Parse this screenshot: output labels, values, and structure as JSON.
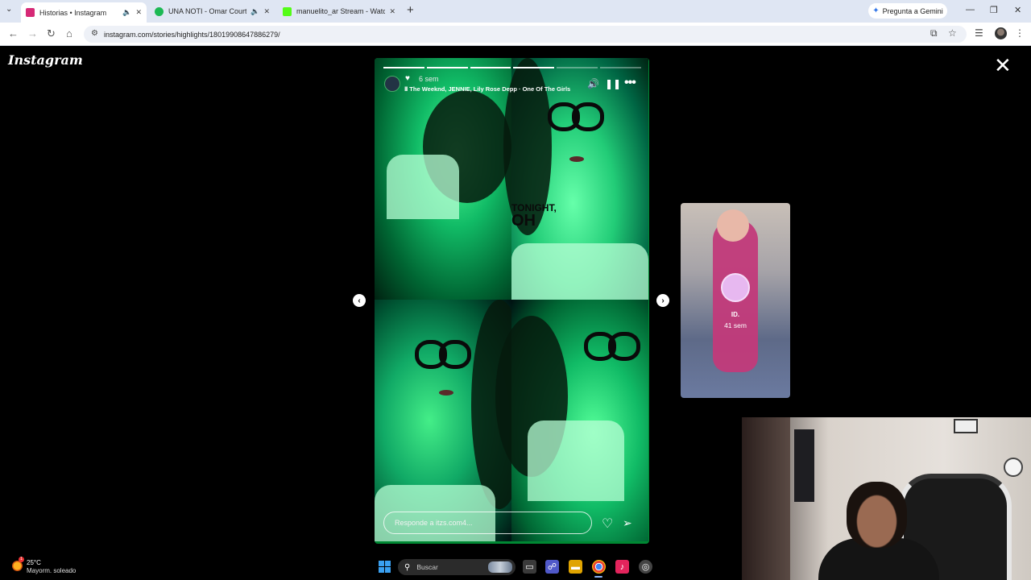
{
  "browser": {
    "tabs": [
      {
        "title": "Historias • Instagram",
        "favicon_color": "#d62976",
        "active": true
      },
      {
        "title": "UNA NOTI - Omar Courtz",
        "favicon_color": "#1db954",
        "active": false
      },
      {
        "title": "manuelito_ar Stream - Watch Li",
        "favicon_color": "#53fc18",
        "active": false
      }
    ],
    "gemini_label": "Pregunta a Gemini",
    "url": "instagram.com/stories/highlights/18019908647886279/"
  },
  "page": {
    "logo": "Instagram",
    "close_icon": "close-icon"
  },
  "story": {
    "time_ago": "6 sem",
    "music_icon": "music-bars-icon",
    "song": "The Weeknd, JENNIE, Lily Rose Depp · One Of The Girls",
    "sticker_line1": "TONIGHT,",
    "sticker_line2": "OH",
    "reply_placeholder": "Responde a itzs.com4...",
    "progress_segments": [
      1,
      1,
      1,
      1,
      0,
      0
    ],
    "accent": "#1faa5a"
  },
  "next_preview": {
    "name": "ID.",
    "time_ago": "41 sem"
  },
  "taskbar": {
    "weather_temp": "25°C",
    "weather_desc": "Mayorm. soleado",
    "weather_badge": "1",
    "search_label": "Buscar"
  }
}
